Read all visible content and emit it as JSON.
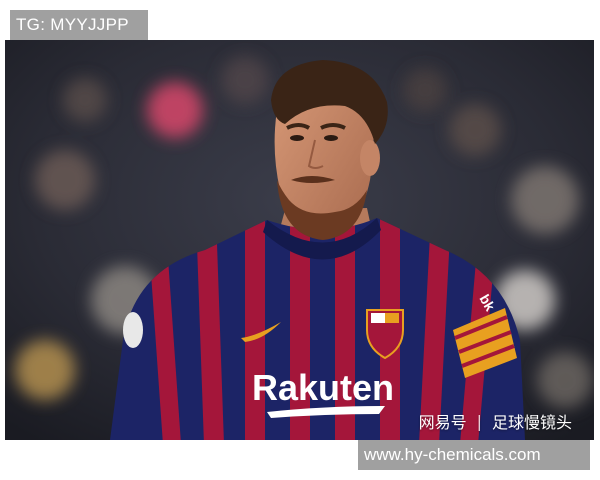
{
  "overlays": {
    "top_left_tag": "TG: MYYJJPP",
    "bottom_right_url": "www.hy-chemicals.com"
  },
  "photo": {
    "jersey_sponsor": "Rakuten",
    "sleeve_brand": "bk",
    "credit_source": "网易号",
    "credit_separator": "|",
    "credit_channel": "足球慢镜头"
  },
  "colors": {
    "label_bg": "#a0a0a0",
    "jersey_blue": "#1c2466",
    "jersey_garnet": "#a4163a",
    "armband": "#e8a020"
  }
}
